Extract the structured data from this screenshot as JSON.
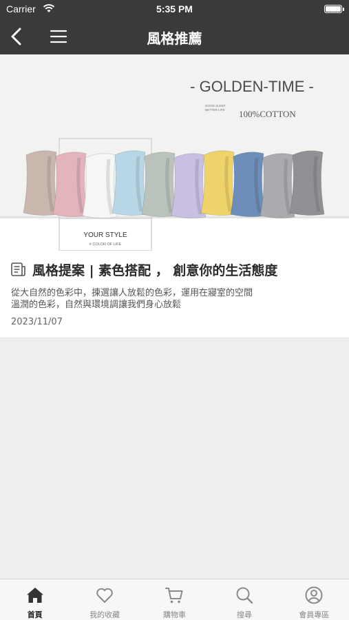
{
  "status_bar": {
    "carrier": "Carrier",
    "time": "5:35 PM"
  },
  "nav": {
    "title": "風格推薦",
    "back_icon": "back-chevron-icon",
    "menu_icon": "hamburger-menu-icon"
  },
  "article": {
    "image_text": {
      "headline": "- GOLDEN-TIME -",
      "small_line1": "GOOD SLEEP",
      "small_line2": "BETTER LIFE",
      "cotton": "100%COTTON",
      "style": "YOUR STYLE",
      "color_of_life": "# COLOR OF LIFE"
    },
    "title": "風格提案 | 素色搭配 ， 創意你的生活態度",
    "description_line1": "從大自然的色彩中，揀選讓人放鬆的色彩，運用在寢室的空間",
    "description_line2": "溫潤的色彩，自然與環境調讓我們身心放鬆",
    "date": "2023/11/07"
  },
  "pillow_colors": [
    "#c9b7ae",
    "#e3b4bc",
    "#f6f6f4",
    "#b7d7e6",
    "#b9c3bc",
    "#c8bfe3",
    "#eed36a",
    "#6d8eb8",
    "#a9abae",
    "#8f9194"
  ],
  "tabbar": {
    "tabs": [
      {
        "label": "首頁",
        "icon": "home-icon",
        "active": true
      },
      {
        "label": "我的收藏",
        "icon": "heart-icon",
        "active": false
      },
      {
        "label": "購物車",
        "icon": "cart-icon",
        "active": false
      },
      {
        "label": "搜尋",
        "icon": "search-icon",
        "active": false
      },
      {
        "label": "會員專區",
        "icon": "user-icon",
        "active": false
      }
    ]
  }
}
